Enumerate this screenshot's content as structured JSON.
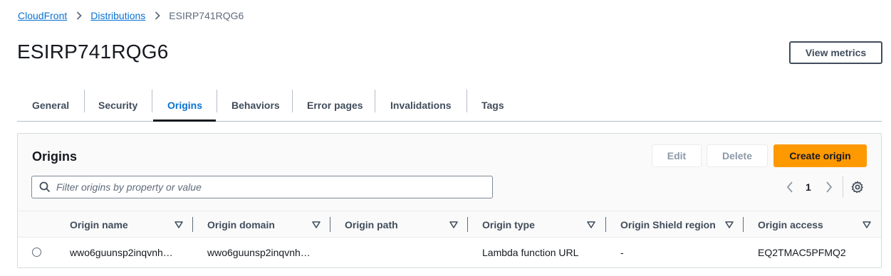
{
  "breadcrumb": {
    "items": [
      "CloudFront",
      "Distributions"
    ],
    "current": "ESIRP741RQG6"
  },
  "page": {
    "title": "ESIRP741RQG6",
    "view_metrics_label": "View metrics"
  },
  "tabs": [
    {
      "label": "General"
    },
    {
      "label": "Security"
    },
    {
      "label": "Origins",
      "active": true
    },
    {
      "label": "Behaviors"
    },
    {
      "label": "Error pages"
    },
    {
      "label": "Invalidations"
    },
    {
      "label": "Tags"
    }
  ],
  "origins": {
    "title": "Origins",
    "edit_label": "Edit",
    "delete_label": "Delete",
    "create_label": "Create origin",
    "filter_placeholder": "Filter origins by property or value",
    "current_page": "1",
    "columns": [
      "Origin name",
      "Origin domain",
      "Origin path",
      "Origin type",
      "Origin Shield region",
      "Origin access"
    ],
    "rows": [
      {
        "origin_name": "wwo6guunsp2inqvnh…",
        "origin_domain": "wwo6guunsp2inqvnh…",
        "origin_path": "",
        "origin_type": "Lambda function URL",
        "origin_shield_region": "-",
        "origin_access": "EQ2TMAC5PFMQ2"
      }
    ]
  },
  "colors": {
    "link": "#0972d3",
    "primary_button": "#ff9900",
    "text": "#16191f",
    "muted": "#5f6b7a"
  },
  "icons": [
    "chevron-right-icon",
    "search-icon",
    "chevron-left-icon",
    "settings-gear-icon",
    "sort-caret-icon",
    "radio-icon"
  ]
}
